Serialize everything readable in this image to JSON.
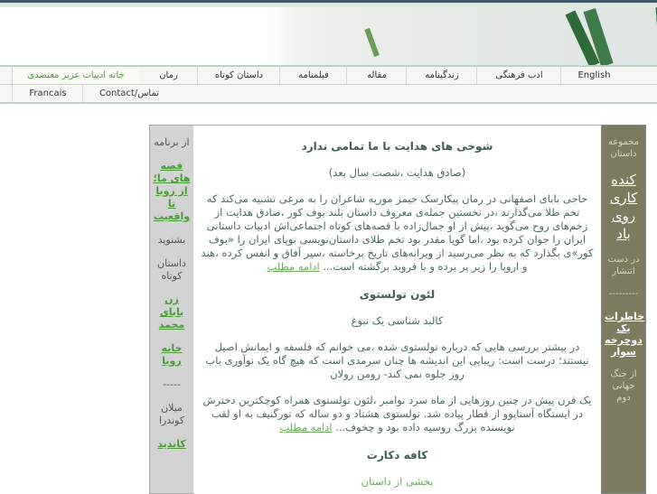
{
  "nav_row1": [
    "English",
    "ادب فرهنگی",
    "زندگینامه",
    "مقاله",
    "فیلمنامه",
    "داستان کوتاه",
    "رمان",
    "خانه ادبیات عزیز معتضدی"
  ],
  "nav_row2": [
    "Francais",
    "Contact/تماس"
  ],
  "left": {
    "items": [
      "از برنامه",
      "قصه های ما؛ از رویا تا واقعیت",
      "بشنوید",
      "داستان کوتاه",
      "زن بابای محمد",
      "خانه رویا",
      "-----",
      "میلان کوندرا",
      "کاندید"
    ]
  },
  "right": {
    "items": [
      "مجموعه داستان",
      "کنده کاری روی باد",
      "در دست انتشار",
      "---------",
      "خاطرات یک دوچرخه سوار",
      "از جنگ جهانی دوم"
    ]
  },
  "main": {
    "a1_title": "شوخی های هدایت با ما تمامی ندارد",
    "a1_sub": "(صادق هدایت ،شصت سال بعد)",
    "a1_body": "حاجی بابای اصفهانی در رمان پیکارسک جیمز موریه شاعران را به مرغی تشبیه می‌کند که تخم طلا می‌گذارند ،در نخستین جمله‌ی معروف داستان بلند بوف کور ،صادق هدایت از زخم‌های روح می‌گوید ،پیش از او جمال‌زاده با قصه‌های کوتاه اجتماعی‌اش ادبیات داستانی ایران را جوان کرده بود ،اما گویا مقدر بود تخم طلای داستان‌نویسی نوپای ایران را «بوف کور»ی بگذارد که به نظر می‌رسید از ویرانه‌های تاریخ برخاسته ،سیر آفاق و انفس کرده ،هند و اروپا را زیر پر برده و با فروبد برگشته است...",
    "more": "ادامه مطلب",
    "a2_title": "لئون تولستوی",
    "a2_sub": "کالبد شناسی یک نبوغ",
    "a2_quote": "در بیشتر بررسی هایی که درباره تولستوی شده ،می خوانم که فلسفه و ایمانش اصیل نیستند؛ درست است: زیبایی این اندیشه ها چنان سرمدی است که هیچ گاه یک نوآوری باب روز جلوه نمی کند- رومن رولان",
    "a2_body": "یک قرن پیش در چنین روزهایی از ماه سرد نوامبر ،لئون تولستوی همراه کوچکترین دخترش در ایستگاه آستاپوو از قطار پیاده شد. تولستوی هشتاد و دو ساله که تورگنیف به او لقب نویسنده بزرگ روسیه داده بود و چخوف...",
    "a3_title": "کافه دکارت",
    "a3_sub": "بخشی از داستان"
  }
}
